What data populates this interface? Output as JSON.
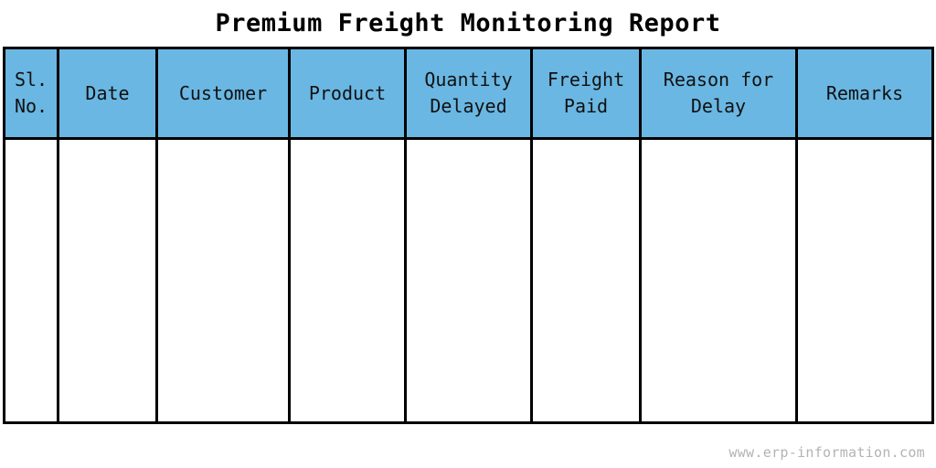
{
  "document": {
    "title": "Premium Freight Monitoring Report"
  },
  "table": {
    "headers": [
      {
        "key": "sl_no",
        "label": "Sl. No."
      },
      {
        "key": "date",
        "label": "Date"
      },
      {
        "key": "customer",
        "label": "Customer"
      },
      {
        "key": "product",
        "label": "Product"
      },
      {
        "key": "quantity_delayed",
        "label": "Quantity Delayed"
      },
      {
        "key": "freight_paid",
        "label": "Freight Paid"
      },
      {
        "key": "reason_for_delay",
        "label": "Reason for Delay"
      },
      {
        "key": "remarks",
        "label": "Remarks"
      }
    ],
    "rows": [
      {
        "sl_no": "",
        "date": "",
        "customer": "",
        "product": "",
        "quantity_delayed": "",
        "freight_paid": "",
        "reason_for_delay": "",
        "remarks": ""
      }
    ],
    "header_background_color": "#6ab7e3",
    "header_text_color": "#111111",
    "border_color": "#000000",
    "body_background_color": "#ffffff"
  },
  "footer": {
    "watermark": "www.erp-information.com",
    "watermark_color": "#b3b3b3"
  }
}
